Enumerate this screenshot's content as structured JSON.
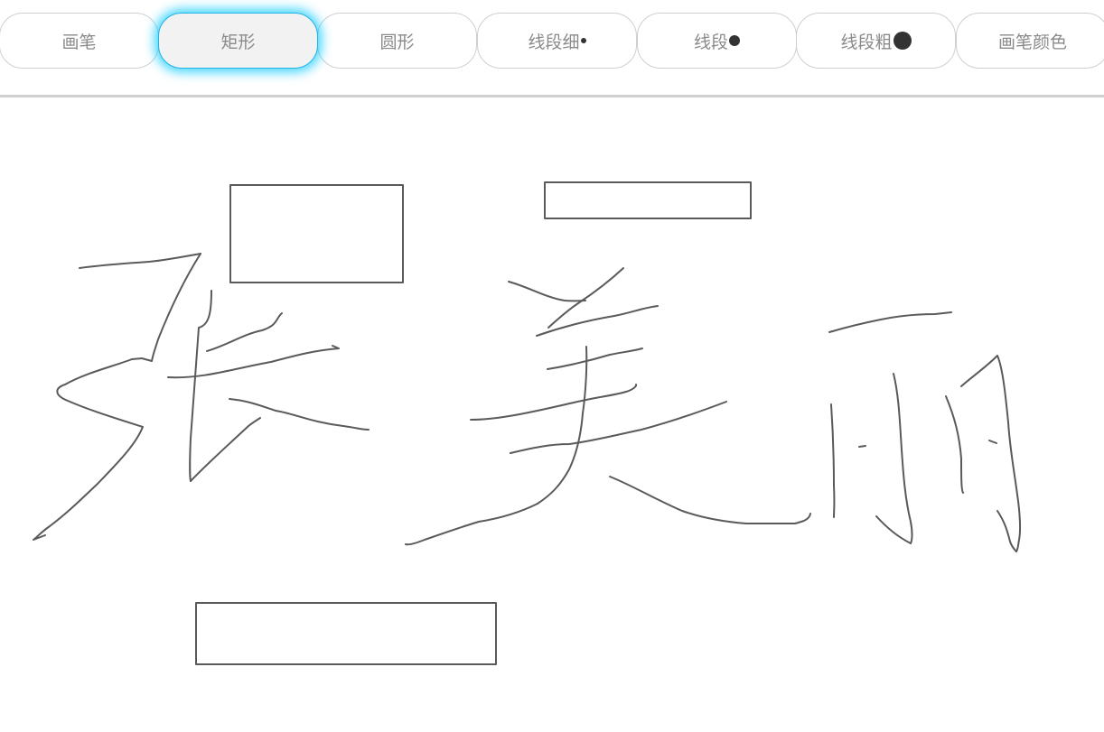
{
  "toolbar": {
    "buttons": [
      {
        "label": "画笔",
        "active": false
      },
      {
        "label": "矩形",
        "active": true
      },
      {
        "label": "圆形",
        "active": false
      },
      {
        "label": "线段细",
        "active": false,
        "dot": "thin"
      },
      {
        "label": "线段",
        "active": false,
        "dot": "medium"
      },
      {
        "label": "线段粗",
        "active": false,
        "dot": "thick"
      },
      {
        "label": "画笔颜色",
        "active": false
      }
    ],
    "active_glow_color": "#00c8ff"
  },
  "canvas": {
    "stroke_color": "#555555",
    "drawing_content": "Hand-drawn characters 张美丽 and three rectangles"
  }
}
